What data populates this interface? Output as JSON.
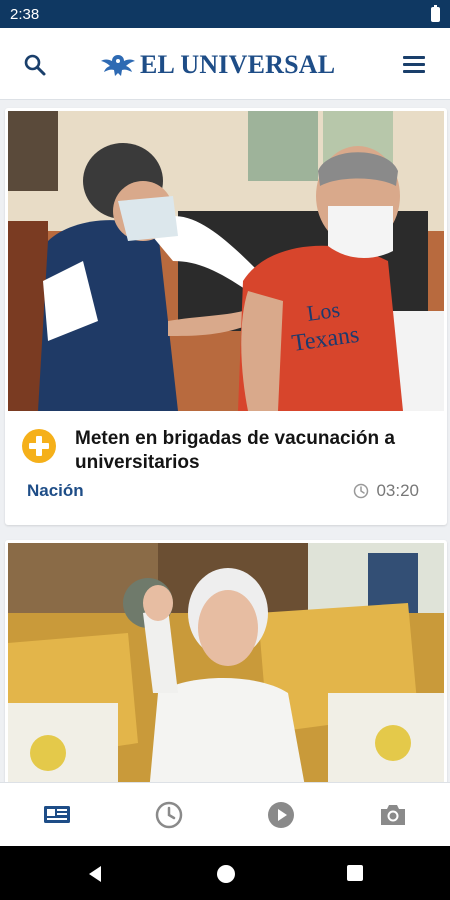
{
  "status_bar": {
    "time": "2:38"
  },
  "header": {
    "logo_text": "EL UNIVERSAL",
    "icons": {
      "search": "search-icon",
      "menu": "hamburger-menu-icon"
    },
    "brand_color": "#1e4d87",
    "status_color": "#0f3862"
  },
  "feed": {
    "articles": [
      {
        "headline": "Meten en brigadas de vacunación a universitarios",
        "section": "Nación",
        "time": "03:20",
        "badge_icon": "plus-circle-icon",
        "badge_color": "#f5b01a",
        "image": "photo: nurse vaccinating a man wearing a face mask and red t-shirt"
      },
      {
        "image": "photo: elderly white-haired woman waving, seated on a yellow sofa with patterned cushions"
      }
    ]
  },
  "bottom_nav": {
    "items": [
      {
        "icon": "news-icon",
        "active": true
      },
      {
        "icon": "clock-icon",
        "active": false
      },
      {
        "icon": "play-icon",
        "active": false
      },
      {
        "icon": "camera-icon",
        "active": false
      }
    ],
    "active_color": "#1e4d87",
    "inactive_color": "#8a8a8a"
  },
  "system_nav": {
    "icons": [
      "back-icon",
      "home-icon",
      "recents-icon"
    ]
  }
}
